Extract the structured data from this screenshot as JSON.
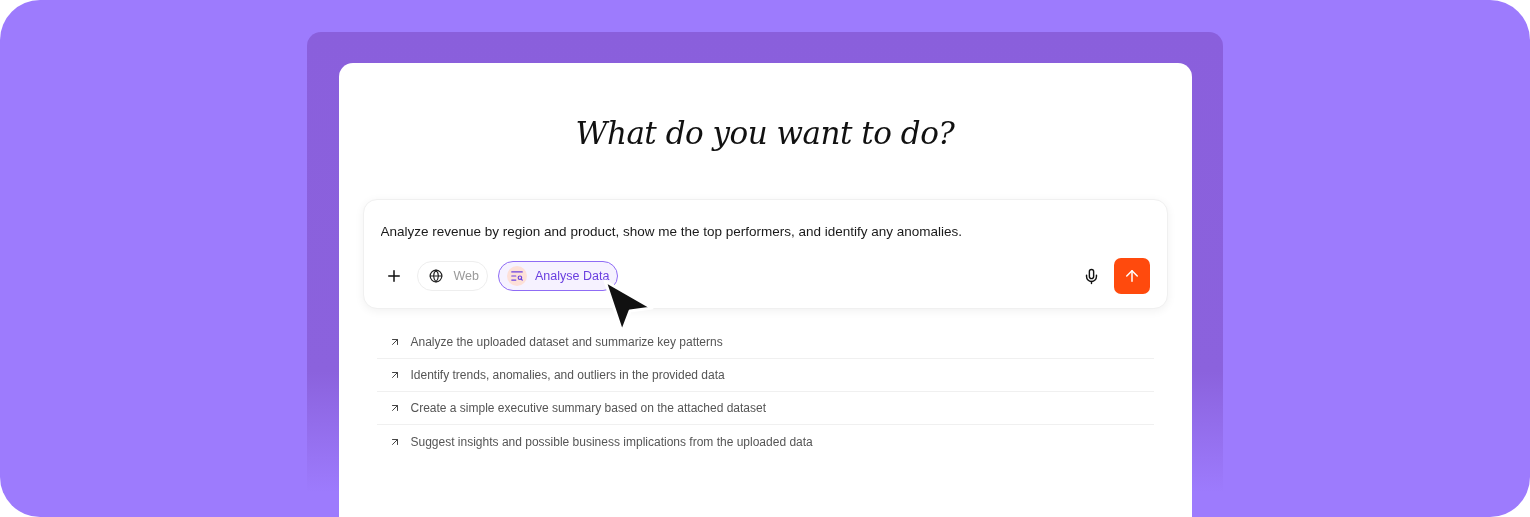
{
  "heading": "What do you want to do?",
  "prompt": {
    "value": "Analyze revenue by region and product, show me the top performers, and identify any anomalies."
  },
  "tools": [
    {
      "kind": "web",
      "label": "Web",
      "selected": false
    },
    {
      "kind": "data",
      "label": "Analyse Data",
      "selected": true
    }
  ],
  "suggestions": [
    "Analyze the uploaded dataset and summarize key patterns",
    "Identify trends, anomalies, and outliers in the provided data",
    "Create a simple executive summary based on the attached dataset",
    "Suggest insights and possible business implications from the uploaded data"
  ]
}
